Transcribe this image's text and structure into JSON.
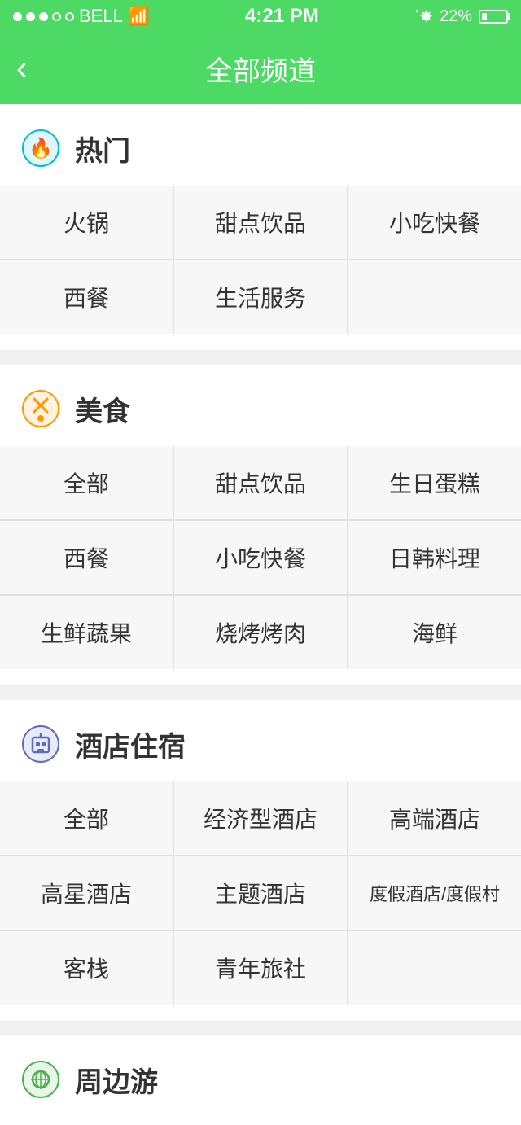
{
  "statusBar": {
    "carrier": "BELL",
    "time": "4:21 PM",
    "battery": "22%",
    "bluetooth": "BT"
  },
  "nav": {
    "title": "全部频道",
    "back": "<"
  },
  "sections": [
    {
      "id": "hot",
      "icon": "flame",
      "title": "热门",
      "items": [
        [
          "火锅",
          "甜点饮品",
          "小吃快餐"
        ],
        [
          "西餐",
          "生活服务"
        ]
      ]
    },
    {
      "id": "food",
      "icon": "food",
      "title": "美食",
      "items": [
        [
          "全部",
          "甜点饮品",
          "生日蛋糕"
        ],
        [
          "西餐",
          "小吃快餐",
          "日韩料理"
        ],
        [
          "生鲜蔬果",
          "烧烤烤肉",
          "海鲜"
        ]
      ]
    },
    {
      "id": "hotel",
      "icon": "hotel",
      "title": "酒店住宿",
      "items": [
        [
          "全部",
          "经济型酒店",
          "高端酒店"
        ],
        [
          "高星酒店",
          "主题酒店",
          "度假酒店/度假村"
        ],
        [
          "客栈",
          "青年旅社"
        ]
      ]
    },
    {
      "id": "tour",
      "icon": "tour",
      "title": "周边游"
    }
  ]
}
